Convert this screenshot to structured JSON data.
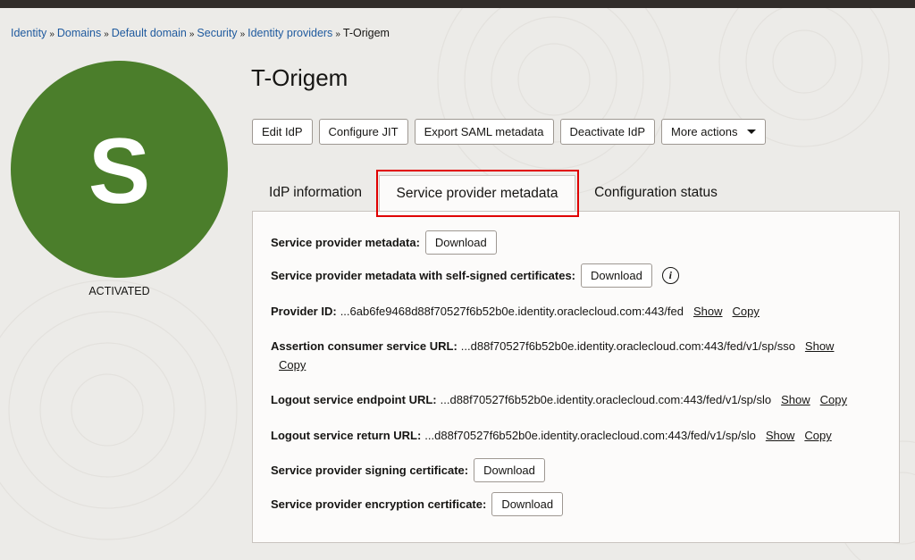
{
  "breadcrumb": [
    "Identity",
    "Domains",
    "Default domain",
    "Security",
    "Identity providers"
  ],
  "breadcrumb_current": "T-Origem",
  "avatar": {
    "letter": "S",
    "color": "#4b7e2b",
    "status": "ACTIVATED"
  },
  "title": "T-Origem",
  "actions": {
    "edit": "Edit IdP",
    "configure_jit": "Configure JIT",
    "export_saml": "Export SAML metadata",
    "deactivate": "Deactivate IdP",
    "more": "More actions"
  },
  "tabs": {
    "idp_information": "IdP information",
    "sp_metadata": "Service provider metadata",
    "config_status": "Configuration status"
  },
  "panel": {
    "sp_metadata_label": "Service provider metadata:",
    "sp_metadata_selfsigned_label": "Service provider metadata with self-signed certificates:",
    "download": "Download",
    "provider_id_label": "Provider ID:",
    "provider_id_value": "...6ab6fe9468d88f70527f6b52b0e.identity.oraclecloud.com:443/fed",
    "acs_url_label": "Assertion consumer service URL:",
    "acs_url_value": "...d88f70527f6b52b0e.identity.oraclecloud.com:443/fed/v1/sp/sso",
    "logout_endpoint_label": "Logout service endpoint URL:",
    "logout_endpoint_value": "...d88f70527f6b52b0e.identity.oraclecloud.com:443/fed/v1/sp/slo",
    "logout_return_label": "Logout service return URL:",
    "logout_return_value": "...d88f70527f6b52b0e.identity.oraclecloud.com:443/fed/v1/sp/slo",
    "signing_cert_label": "Service provider signing certificate:",
    "encryption_cert_label": "Service provider encryption certificate:",
    "show": "Show",
    "copy": "Copy"
  }
}
